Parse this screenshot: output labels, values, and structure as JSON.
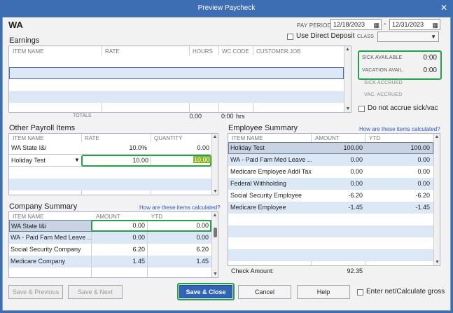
{
  "window": {
    "title": "Preview Paycheck",
    "close": "✕"
  },
  "employee_name": "WA",
  "pay_period": {
    "label": "PAY PERIOD",
    "start": "12/18/2023",
    "end": "12/31/2023",
    "dash": "-"
  },
  "direct_deposit": "Use Direct Deposit",
  "class_label": "CLASS",
  "earnings": {
    "title": "Earnings",
    "headers": [
      "ITEM NAME",
      "RATE",
      "HOURS",
      "WC CODE",
      "CUSTOMER:JOB"
    ],
    "totals_label": "TOTALS",
    "total_hours_a": "0.00",
    "total_hours_b": "0:00",
    "hrs": "hrs"
  },
  "sick": {
    "sick_available_label": "SICK AVAILABLE",
    "sick_available": "0:00",
    "vacation_label": "VACATION AVAIL.",
    "vacation": "0:00",
    "sick_accrued": "SICK ACCRUED",
    "vac_accrued": "VAC. ACCRUED",
    "no_accrue": "Do not accrue sick/vac"
  },
  "other_payroll": {
    "title": "Other Payroll Items",
    "headers": [
      "ITEM NAME",
      "RATE",
      "QUANTITY"
    ],
    "rows": [
      {
        "name": "WA State I&i",
        "rate": "10.0%",
        "qty": "0.00"
      },
      {
        "name": "Holiday Test",
        "rate": "10.00",
        "qty": "10.00"
      }
    ]
  },
  "employee_summary": {
    "title": "Employee Summary",
    "link": "How are these items calculated?",
    "headers": [
      "ITEM NAME",
      "AMOUNT",
      "YTD"
    ],
    "rows": [
      {
        "name": "Holiday Test",
        "amount": "100.00",
        "ytd": "100.00"
      },
      {
        "name": "WA - Paid Fam Med Leave ...",
        "amount": "0.00",
        "ytd": "0.00"
      },
      {
        "name": "Medicare Employee Addl Tax",
        "amount": "0.00",
        "ytd": "0.00"
      },
      {
        "name": "Federal Withholding",
        "amount": "0.00",
        "ytd": "0.00"
      },
      {
        "name": "Social Security Employee",
        "amount": "-6.20",
        "ytd": "-6.20"
      },
      {
        "name": "Medicare Employee",
        "amount": "-1.45",
        "ytd": "-1.45"
      }
    ],
    "check_amount_label": "Check Amount:",
    "check_amount": "92.35"
  },
  "company_summary": {
    "title": "Company Summary",
    "link": "How are these items calculated?",
    "headers": [
      "ITEM NAME",
      "AMOUNT",
      "YTD"
    ],
    "rows": [
      {
        "name": "WA State I&i",
        "amount": "0.00",
        "ytd": "0.00"
      },
      {
        "name": "WA - Paid Fam Med Leave ...",
        "amount": "0.00",
        "ytd": "0.00"
      },
      {
        "name": "Social Security Company",
        "amount": "6.20",
        "ytd": "6.20"
      },
      {
        "name": "Medicare Company",
        "amount": "1.45",
        "ytd": "1.45"
      }
    ]
  },
  "buttons": {
    "save_previous": "Save & Previous",
    "save_next": "Save & Next",
    "save_close": "Save & Close",
    "cancel": "Cancel",
    "help": "Help",
    "enter_net": "Enter net/Calculate gross"
  },
  "colors": {
    "highlight": "#22a04a",
    "title_bar": "#3d6eb4",
    "primary_button": "#3164b8"
  }
}
